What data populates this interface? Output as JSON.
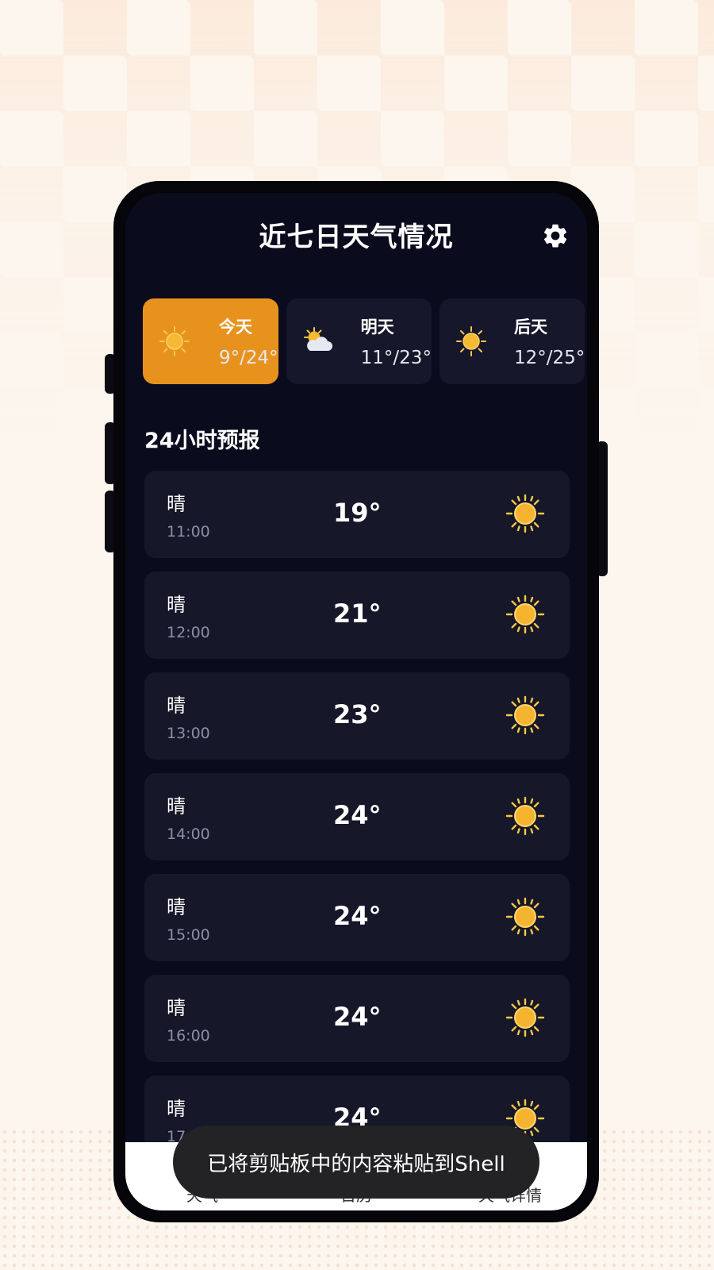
{
  "header": {
    "title": "近七日天气情况",
    "settings_icon": "gear-icon"
  },
  "days": [
    {
      "label": "今天",
      "temp": "9°/24°",
      "icon": "sun-icon",
      "active": true
    },
    {
      "label": "明天",
      "temp": "11°/23°",
      "icon": "partly-cloudy-icon",
      "active": false
    },
    {
      "label": "后天",
      "temp": "12°/25°",
      "icon": "sun-icon",
      "active": false
    },
    {
      "label": "",
      "temp": "",
      "icon": "sun-icon",
      "active": false
    }
  ],
  "forecast": {
    "title": "24小时预报",
    "hours": [
      {
        "condition": "晴",
        "time": "11:00",
        "temp": "19°",
        "icon": "sun-icon"
      },
      {
        "condition": "晴",
        "time": "12:00",
        "temp": "21°",
        "icon": "sun-icon"
      },
      {
        "condition": "晴",
        "time": "13:00",
        "temp": "23°",
        "icon": "sun-icon"
      },
      {
        "condition": "晴",
        "time": "14:00",
        "temp": "24°",
        "icon": "sun-icon"
      },
      {
        "condition": "晴",
        "time": "15:00",
        "temp": "24°",
        "icon": "sun-icon"
      },
      {
        "condition": "晴",
        "time": "16:00",
        "temp": "24°",
        "icon": "sun-icon"
      },
      {
        "condition": "晴",
        "time": "17:00",
        "temp": "24°",
        "icon": "sun-icon"
      }
    ]
  },
  "tabs": [
    {
      "label": "天气"
    },
    {
      "label": "日历"
    },
    {
      "label": "天气详情"
    }
  ],
  "toast": {
    "text": "已将剪贴板中的内容粘贴到Shell"
  },
  "colors": {
    "accent": "#e8921e",
    "background": "#0b0b1e",
    "card": "#161729"
  }
}
